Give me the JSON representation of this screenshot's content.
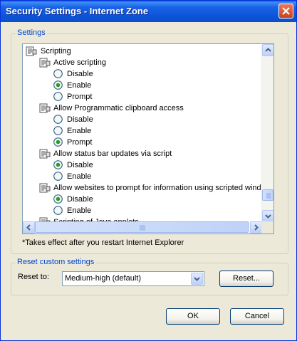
{
  "window": {
    "title": "Security Settings - Internet Zone"
  },
  "settings_group": {
    "legend": "Settings"
  },
  "tree": [
    {
      "kind": "category",
      "label": "Scripting"
    },
    {
      "kind": "setting",
      "label": "Active scripting"
    },
    {
      "kind": "option",
      "label": "Disable",
      "selected": false
    },
    {
      "kind": "option",
      "label": "Enable",
      "selected": true
    },
    {
      "kind": "option",
      "label": "Prompt",
      "selected": false
    },
    {
      "kind": "setting",
      "label": "Allow Programmatic clipboard access"
    },
    {
      "kind": "option",
      "label": "Disable",
      "selected": false
    },
    {
      "kind": "option",
      "label": "Enable",
      "selected": false
    },
    {
      "kind": "option",
      "label": "Prompt",
      "selected": true
    },
    {
      "kind": "setting",
      "label": "Allow status bar updates via script"
    },
    {
      "kind": "option",
      "label": "Disable",
      "selected": true
    },
    {
      "kind": "option",
      "label": "Enable",
      "selected": false
    },
    {
      "kind": "setting",
      "label": "Allow websites to prompt for information using scripted windows"
    },
    {
      "kind": "option",
      "label": "Disable",
      "selected": true
    },
    {
      "kind": "option",
      "label": "Enable",
      "selected": false
    },
    {
      "kind": "setting",
      "label": "Scripting of Java applets"
    }
  ],
  "note": "*Takes effect after you restart Internet Explorer",
  "reset_group": {
    "legend": "Reset custom settings",
    "reset_to_label": "Reset to:",
    "selected_level": "Medium-high (default)",
    "reset_button": "Reset..."
  },
  "buttons": {
    "ok": "OK",
    "cancel": "Cancel"
  },
  "colors": {
    "titlebar": "#0c55d9",
    "legend_text": "#0046d5",
    "dialog_bg": "#ece9d8",
    "radio_dot": "#21a121"
  }
}
